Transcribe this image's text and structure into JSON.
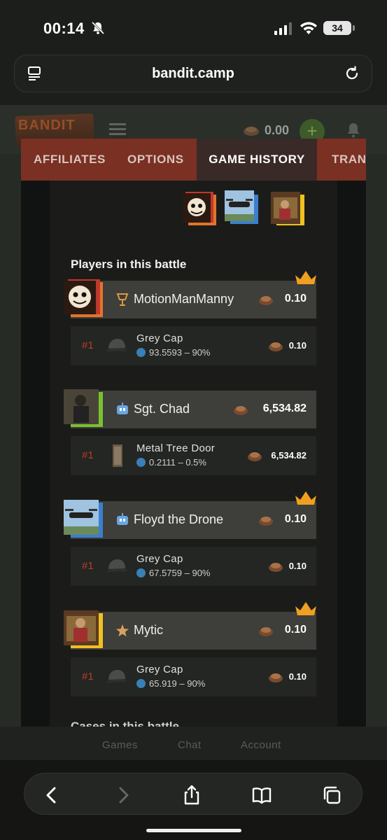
{
  "status_bar": {
    "time": "00:14",
    "battery": "34"
  },
  "browser": {
    "url": "bandit.camp"
  },
  "site_header": {
    "logo": "BANDIT",
    "balance": "0.00",
    "add_label": "+"
  },
  "tabs": [
    {
      "label": "AFFILIATES"
    },
    {
      "label": "OPTIONS"
    },
    {
      "label": "GAME HISTORY"
    },
    {
      "label": "TRANS"
    }
  ],
  "battle": {
    "section_title": "Players in this battle",
    "players": [
      {
        "name": "MotionManManny",
        "value": "0.10",
        "winner": true,
        "rank_icon": "trophy-rank-icon",
        "item": {
          "rank": "#1",
          "name": "Grey Cap",
          "ticket": "93.5593",
          "chance": "90%",
          "value": "0.10"
        }
      },
      {
        "name": "Sgt. Chad",
        "value": "6,534.82",
        "winner": false,
        "rank_icon": "bot-icon",
        "item": {
          "rank": "#1",
          "name": "Metal Tree Door",
          "ticket": "0.2111",
          "chance": "0.5%",
          "value": "6,534.82"
        }
      },
      {
        "name": "Floyd the Drone",
        "value": "0.10",
        "winner": true,
        "rank_icon": "bot-icon",
        "item": {
          "rank": "#1",
          "name": "Grey Cap",
          "ticket": "67.5759",
          "chance": "90%",
          "value": "0.10"
        }
      },
      {
        "name": "Mytic",
        "value": "0.10",
        "winner": true,
        "rank_icon": "star-rank-icon",
        "item": {
          "rank": "#1",
          "name": "Grey Cap",
          "ticket": "65.919",
          "chance": "90%",
          "value": "0.10"
        }
      }
    ],
    "cutoff_title": "Cases in this battle"
  },
  "bottom_nav": {
    "games": "Games",
    "chat": "Chat",
    "account": "Account"
  },
  "colors": {
    "tab_bar": "#7a3022",
    "crown": "#f0a020",
    "rank": "#c0392b",
    "ticket": "#3a7fb7"
  }
}
